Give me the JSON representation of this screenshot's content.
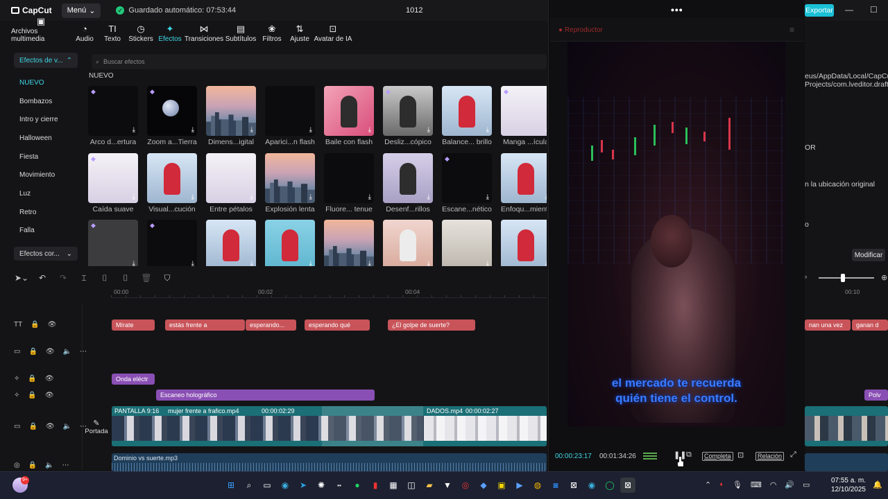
{
  "app": {
    "logo": "CapCut",
    "menu": "Menú",
    "autosave": "Guardado automático: 07:53:44",
    "project": "1012",
    "export": "Exportar"
  },
  "toolbar": [
    {
      "label": "Archivos multimedia",
      "icon": "media-icon"
    },
    {
      "label": "Audio",
      "icon": "audio-icon"
    },
    {
      "label": "Texto",
      "icon": "text-icon"
    },
    {
      "label": "Stickers",
      "icon": "sticker-icon"
    },
    {
      "label": "Efectos",
      "icon": "effects-icon",
      "active": true
    },
    {
      "label": "Transiciones",
      "icon": "transitions-icon"
    },
    {
      "label": "Subtítulos",
      "icon": "subtitles-icon"
    },
    {
      "label": "Filtros",
      "icon": "filters-icon"
    },
    {
      "label": "Ajuste",
      "icon": "adjust-icon"
    },
    {
      "label": "Avatar de IA",
      "icon": "ai-avatar-icon"
    }
  ],
  "categories": {
    "header": "Efectos de v...",
    "items": [
      "NUEVO",
      "Bombazos",
      "Intro y cierre",
      "Halloween",
      "Fiesta",
      "Movimiento",
      "Luz",
      "Retro",
      "Falla"
    ],
    "footer": "Efectos cor..."
  },
  "effects": {
    "search_placeholder": "Buscar efectos",
    "section": "NUEVO",
    "cards": [
      {
        "label": "Arco d...ertura",
        "thumb": "black",
        "gem": true
      },
      {
        "label": "Zoom a...Tierra",
        "thumb": "moon",
        "gem": true
      },
      {
        "label": "Dimens...igital",
        "thumb": "city"
      },
      {
        "label": "Aparici...n flash",
        "thumb": "black"
      },
      {
        "label": "Baile con flash",
        "thumb": "pink"
      },
      {
        "label": "Desliz...cópico",
        "thumb": "gray",
        "gem": true
      },
      {
        "label": "Balance... brillo",
        "thumb": "blue"
      },
      {
        "label": "Manga ...ícula",
        "thumb": "white",
        "gem": true
      },
      {
        "label": "Caída suave",
        "thumb": "white",
        "gem": true
      },
      {
        "label": "Visual...cución",
        "thumb": "blue"
      },
      {
        "label": "Entre pétalos",
        "thumb": "white"
      },
      {
        "label": "Explosión lenta",
        "thumb": "city"
      },
      {
        "label": "Fluore... tenue",
        "thumb": "black"
      },
      {
        "label": "Desenf...rillos",
        "thumb": "lav"
      },
      {
        "label": "Escane...nético",
        "thumb": "black",
        "gem": true
      },
      {
        "label": "Enfoqu...miento",
        "thumb": "blue"
      },
      {
        "label": "",
        "thumb": "dgray",
        "gem": true
      },
      {
        "label": "",
        "thumb": "black",
        "gem": true
      },
      {
        "label": "",
        "thumb": "blue"
      },
      {
        "label": "",
        "thumb": "sky"
      },
      {
        "label": "",
        "thumb": "city"
      },
      {
        "label": "",
        "thumb": "pin2"
      },
      {
        "label": "",
        "thumb": "paper"
      },
      {
        "label": "",
        "thumb": "blue"
      }
    ]
  },
  "properties": {
    "path1": "eus/AppData/Local/CapCut",
    "path2": "Projects/com.lveditor.draft",
    "line3": "OR",
    "line4": "n la ubicación original",
    "line5": "o",
    "modify": "Modificar"
  },
  "player": {
    "title": "Reproductor",
    "subtitle_line1": "el mercado te recuerda",
    "subtitle_line2": "quién tiene el control.",
    "time_current": "00:00:23:17",
    "time_total": "00:01:34:26",
    "full": "Completa",
    "ratio": "Relación"
  },
  "timeline": {
    "ticks": [
      "00:00",
      "00:02",
      "00:04"
    ],
    "right_tick": "00:10",
    "text_clips": [
      {
        "label": "Mírate"
      },
      {
        "label": "estás frente a"
      },
      {
        "label": "esperando..."
      },
      {
        "label": "esperando qué"
      },
      {
        "label": "¿El golpe de suerte?"
      }
    ],
    "right_text_clips": [
      "nan una vez",
      "ganan d"
    ],
    "fx_clips": [
      "Onda eléctr",
      "Escaneo holográfico"
    ],
    "right_fx_clip": "Polv",
    "cover_label": "Portada",
    "main_labels": [
      "PANTALLA 9:16",
      "mujer frente a frafico.mp4",
      "00:00:02:29",
      "DADOS.mp4",
      "00:00:02:27"
    ],
    "audio_label": "Dominio vs suerte.mp3"
  },
  "taskbar": {
    "badge": "9+",
    "time": "07:55 a. m.",
    "date": "12/10/2025"
  },
  "colors": {
    "accent": "#3fd8e8",
    "text_clip": "#c8545a",
    "fx_clip": "#8a4fb4",
    "main_track": "#1b6f76",
    "audio_track": "#1f3e5a"
  }
}
